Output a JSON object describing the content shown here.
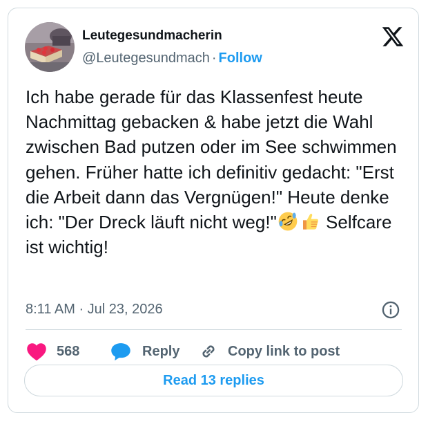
{
  "author": {
    "display_name": "Leutegesundmacherin",
    "handle": "@Leutegesundmach",
    "separator": "·",
    "follow_label": "Follow"
  },
  "tweet": {
    "text_part1": "Ich habe gerade für das Klassenfest heute Nachmittag gebacken & habe jetzt die Wahl zwischen Bad putzen oder im See schwimmen gehen. Früher hatte ich definitiv gedacht: \"Erst die Arbeit dann das Vergnügen!\" Heute denke ich: \"Der Dreck läuft nicht weg!\"",
    "emojis": [
      "rolling-on-floor-laughing-emoji",
      "thumbs-up-emoji"
    ],
    "text_part2": " Selfcare ist wichtig!",
    "timestamp": "8:11 AM · Jul 23, 2026"
  },
  "actions": {
    "like_count": "568",
    "reply_label": "Reply",
    "copy_link_label": "Copy link to post"
  },
  "read_replies_label": "Read 13 replies",
  "icons": {
    "brand": "x-logo-icon",
    "info": "info-icon",
    "like": "heart-icon",
    "reply": "speech-bubble-icon",
    "copy": "link-icon"
  },
  "colors": {
    "accent": "#1d9bf0",
    "like": "#f91880",
    "muted": "#536471",
    "text": "#0f1419",
    "border": "#cfd9de"
  }
}
